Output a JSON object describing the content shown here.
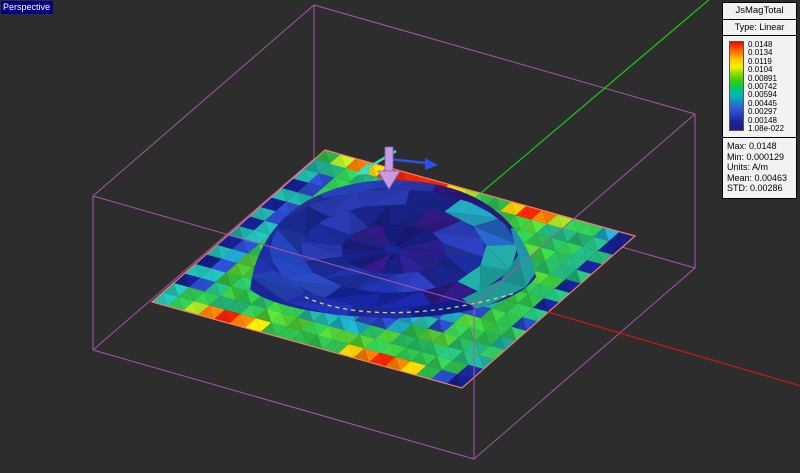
{
  "viewport": {
    "view_label": "Perspective"
  },
  "legend": {
    "title": "JsMagTotal",
    "scale_type": "Type: Linear",
    "scale_values": [
      "0.0148",
      "0.0134",
      "0.0119",
      "0.0104",
      "0.00891",
      "0.00742",
      "0.00594",
      "0.00445",
      "0.00297",
      "0.00148",
      "1.08e-022"
    ],
    "stats": [
      "Max: 0.0148",
      "Min: 0.000129",
      "Units: A/m",
      "Mean: 0.00463",
      "STD: 0.00286"
    ]
  },
  "colorbar_gradient": [
    "#ff0000 0%",
    "#ff6a00 10%",
    "#ffc800 20%",
    "#f2f200 28%",
    "#8fd900 36%",
    "#2ecc12 45%",
    "#00c47e 54%",
    "#00b4b8 62%",
    "#2e6ad8 72%",
    "#2742c4 82%",
    "#1b2496 91%",
    "#2e1288 100%"
  ],
  "colors": {
    "background": "#2d2d2d",
    "wireframe": "#a757ab",
    "plate_outline": "#ef7e6e",
    "axis_green": "#16cd16",
    "axis_red": "#d01616",
    "dash_yellow": "#dede55",
    "arrow_k_fill": "#c79ae2",
    "arrow_k_edge": "#8a5fb8",
    "arrow_e": "#2b50e8",
    "arrow_h": "#3adcc4",
    "label_bg": "#000080",
    "label_fg": "#ffffff"
  }
}
